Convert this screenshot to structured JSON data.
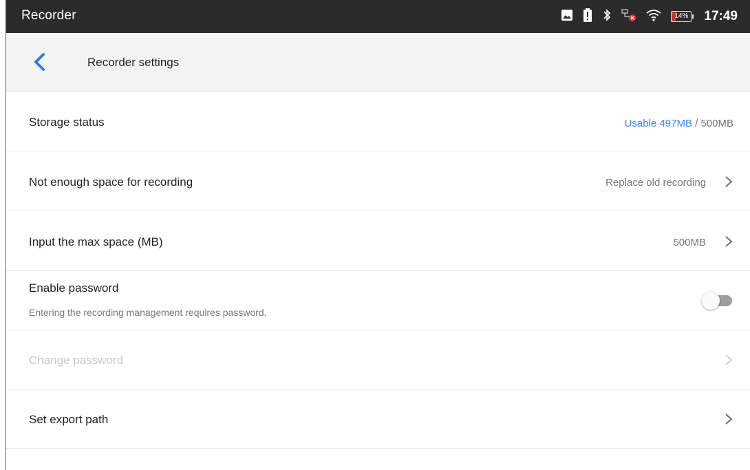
{
  "statusbar": {
    "app_title": "Recorder",
    "time": "17:49",
    "battery_level": "14%",
    "icons": [
      "image-icon",
      "battery-alert-icon",
      "bluetooth-icon",
      "network-error-icon",
      "wifi-icon",
      "battery-icon"
    ]
  },
  "header": {
    "title": "Recorder settings",
    "back_icon": "chevron-left-icon"
  },
  "colors": {
    "accent": "#3b82f6",
    "statusbar_bg": "#2b2b2b",
    "header_bg": "#f3f3f3"
  },
  "settings": {
    "storage": {
      "label": "Storage status",
      "usable": "Usable 497MB",
      "separator": " / ",
      "total": "500MB"
    },
    "not_enough_space": {
      "label": "Not enough space for recording",
      "value": "Replace old recording"
    },
    "max_space": {
      "label": "Input the max space (MB)",
      "value": "500MB"
    },
    "enable_password": {
      "label": "Enable password",
      "description": "Entering the recording management requires password.",
      "enabled": false
    },
    "change_password": {
      "label": "Change password",
      "disabled": true
    },
    "export_path": {
      "label": "Set export path"
    }
  }
}
